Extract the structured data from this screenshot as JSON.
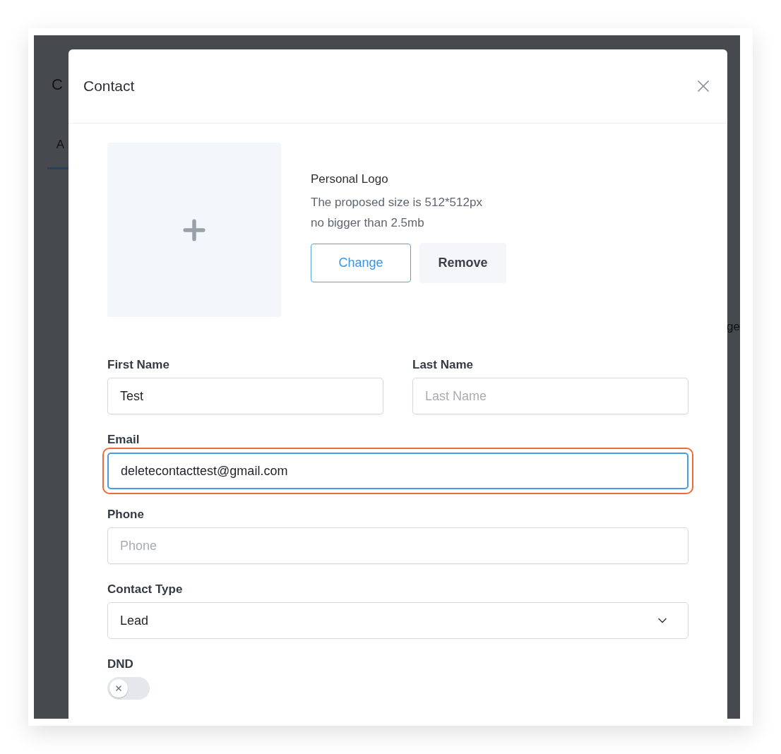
{
  "background": {
    "title": "C",
    "tab": "A",
    "side_text": "ge"
  },
  "dialog": {
    "title": "Contact",
    "logo": {
      "title": "Personal Logo",
      "hint_lines": [
        "The proposed size is 512*512px",
        "no bigger than 2.5mb"
      ],
      "buttons": [
        {
          "label": "Change",
          "kind": "outline"
        },
        {
          "label": "Remove",
          "kind": "subtle"
        }
      ]
    },
    "rows": [
      [
        {
          "kind": "text",
          "label": "First Name",
          "value": "Test"
        },
        {
          "kind": "text",
          "label": "Last Name",
          "placeholder": "Last Name"
        }
      ],
      [
        {
          "kind": "text",
          "label": "Email",
          "value": "deletecontacttest@gmail.com",
          "focused": true,
          "highlighted": true
        }
      ],
      [
        {
          "kind": "text",
          "label": "Phone",
          "placeholder": "Phone"
        }
      ],
      [
        {
          "kind": "select",
          "label": "Contact Type",
          "value": "Lead"
        }
      ],
      [
        {
          "kind": "toggle",
          "label": "DND",
          "on": false
        }
      ]
    ]
  }
}
